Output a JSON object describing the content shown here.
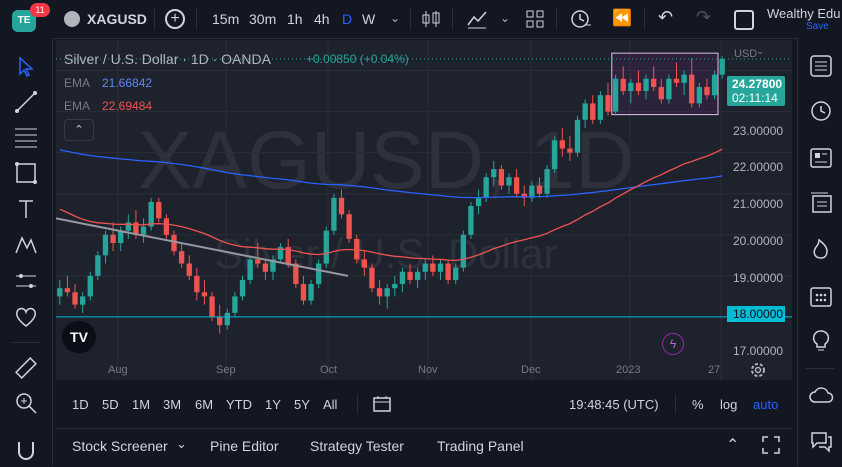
{
  "header": {
    "notification_count": "11",
    "symbol": "XAGUSD",
    "intervals": [
      "15m",
      "30m",
      "1h",
      "4h",
      "D",
      "W"
    ],
    "active_interval": "D",
    "layout_name": "Wealthy Edu",
    "save_label": "Save"
  },
  "legend": {
    "title": "Silver / U.S. Dollar · 1D · OANDA",
    "change": "+0.00850 (+0.04%)",
    "ema1_label": "EMA",
    "ema1_value": "21.66842",
    "ema2_label": "EMA",
    "ema2_value": "22.69484"
  },
  "watermark": {
    "symbol": "XAGUSD, 1D",
    "name": "Silver / U.S. Dollar"
  },
  "price_axis": {
    "currency": "USD",
    "ticks": [
      "23.00000",
      "22.00000",
      "21.00000",
      "20.00000",
      "19.00000",
      "18.00000",
      "17.00000"
    ],
    "current_price": "24.27800",
    "countdown": "02:11:14",
    "line_price": "18.00000"
  },
  "time_axis": {
    "ticks": [
      "Aug",
      "Sep",
      "Oct",
      "Nov",
      "Dec",
      "2023",
      "27"
    ]
  },
  "ranges": [
    "1D",
    "5D",
    "1M",
    "3M",
    "6M",
    "YTD",
    "1Y",
    "5Y",
    "All"
  ],
  "clock": "19:48:45 (UTC)",
  "scale_options": {
    "percent": "%",
    "log": "log",
    "auto": "auto"
  },
  "bottom_tabs": [
    "Stock Screener",
    "Pine Editor",
    "Strategy Tester",
    "Trading Panel"
  ],
  "colors": {
    "up": "#26a69a",
    "down": "#ef5350",
    "ema_fast": "#ef5350",
    "ema_slow": "#2962ff",
    "accent": "#2962ff",
    "hline": "#00bcd4"
  },
  "chart_data": {
    "type": "candlestick",
    "ylim": [
      17.0,
      24.5
    ],
    "candles": [
      [
        18.5,
        18.9,
        18.3,
        18.7
      ],
      [
        18.7,
        19.0,
        18.5,
        18.6
      ],
      [
        18.6,
        18.8,
        18.2,
        18.3
      ],
      [
        18.3,
        18.6,
        18.1,
        18.5
      ],
      [
        18.5,
        19.1,
        18.4,
        19.0
      ],
      [
        19.0,
        19.6,
        18.9,
        19.5
      ],
      [
        19.5,
        20.1,
        19.3,
        20.0
      ],
      [
        20.0,
        20.3,
        19.6,
        19.8
      ],
      [
        19.8,
        20.2,
        19.6,
        20.1
      ],
      [
        20.1,
        20.5,
        19.9,
        20.3
      ],
      [
        20.3,
        20.6,
        19.9,
        20.0
      ],
      [
        20.0,
        20.4,
        19.8,
        20.2
      ],
      [
        20.2,
        20.9,
        20.1,
        20.8
      ],
      [
        20.8,
        20.9,
        20.3,
        20.4
      ],
      [
        20.4,
        20.5,
        19.9,
        20.0
      ],
      [
        20.0,
        20.1,
        19.5,
        19.6
      ],
      [
        19.6,
        19.8,
        19.2,
        19.3
      ],
      [
        19.3,
        19.5,
        18.9,
        19.0
      ],
      [
        19.0,
        19.2,
        18.4,
        18.6
      ],
      [
        18.6,
        18.9,
        18.3,
        18.5
      ],
      [
        18.5,
        18.6,
        17.9,
        18.0
      ],
      [
        18.0,
        18.3,
        17.6,
        17.8
      ],
      [
        17.8,
        18.2,
        17.7,
        18.1
      ],
      [
        18.1,
        18.6,
        18.0,
        18.5
      ],
      [
        18.5,
        19.0,
        18.4,
        18.9
      ],
      [
        18.9,
        19.5,
        18.8,
        19.4
      ],
      [
        19.4,
        19.8,
        19.2,
        19.3
      ],
      [
        19.3,
        19.4,
        18.9,
        19.1
      ],
      [
        19.1,
        19.5,
        18.9,
        19.4
      ],
      [
        19.4,
        19.8,
        19.3,
        19.7
      ],
      [
        19.7,
        19.9,
        19.2,
        19.3
      ],
      [
        19.3,
        19.4,
        18.7,
        18.8
      ],
      [
        18.8,
        19.0,
        18.3,
        18.4
      ],
      [
        18.4,
        18.9,
        18.3,
        18.8
      ],
      [
        18.8,
        19.4,
        18.7,
        19.3
      ],
      [
        19.3,
        20.2,
        19.2,
        20.1
      ],
      [
        20.1,
        21.0,
        20.0,
        20.9
      ],
      [
        20.9,
        21.1,
        20.4,
        20.5
      ],
      [
        20.5,
        20.6,
        19.8,
        19.9
      ],
      [
        19.9,
        20.0,
        19.3,
        19.4
      ],
      [
        19.4,
        19.6,
        19.0,
        19.2
      ],
      [
        19.2,
        19.3,
        18.6,
        18.7
      ],
      [
        18.7,
        18.9,
        18.3,
        18.5
      ],
      [
        18.5,
        18.8,
        18.2,
        18.7
      ],
      [
        18.7,
        19.0,
        18.5,
        18.8
      ],
      [
        18.8,
        19.2,
        18.6,
        19.1
      ],
      [
        19.1,
        19.3,
        18.8,
        18.9
      ],
      [
        18.9,
        19.2,
        18.7,
        19.1
      ],
      [
        19.1,
        19.4,
        18.9,
        19.3
      ],
      [
        19.3,
        19.5,
        19.0,
        19.1
      ],
      [
        19.1,
        19.4,
        18.9,
        19.3
      ],
      [
        19.3,
        19.4,
        18.8,
        18.9
      ],
      [
        18.9,
        19.3,
        18.8,
        19.2
      ],
      [
        19.2,
        20.1,
        19.1,
        20.0
      ],
      [
        20.0,
        20.8,
        19.9,
        20.7
      ],
      [
        20.7,
        21.1,
        20.5,
        20.9
      ],
      [
        20.9,
        21.5,
        20.8,
        21.4
      ],
      [
        21.4,
        21.8,
        21.2,
        21.6
      ],
      [
        21.6,
        21.7,
        21.1,
        21.2
      ],
      [
        21.2,
        21.5,
        21.0,
        21.4
      ],
      [
        21.4,
        21.6,
        20.9,
        21.0
      ],
      [
        21.0,
        21.2,
        20.7,
        20.9
      ],
      [
        20.9,
        21.3,
        20.8,
        21.2
      ],
      [
        21.2,
        21.4,
        20.9,
        21.0
      ],
      [
        21.0,
        21.7,
        20.9,
        21.6
      ],
      [
        21.6,
        22.4,
        21.5,
        22.3
      ],
      [
        22.3,
        22.6,
        21.9,
        22.1
      ],
      [
        22.1,
        22.4,
        21.8,
        22.0
      ],
      [
        22.0,
        22.9,
        21.9,
        22.8
      ],
      [
        22.8,
        23.3,
        22.6,
        23.2
      ],
      [
        23.2,
        23.4,
        22.7,
        22.8
      ],
      [
        22.8,
        23.5,
        22.7,
        23.4
      ],
      [
        23.4,
        23.7,
        22.9,
        23.0
      ],
      [
        23.0,
        23.9,
        22.9,
        23.8
      ],
      [
        23.8,
        24.1,
        23.4,
        23.5
      ],
      [
        23.5,
        23.8,
        23.2,
        23.7
      ],
      [
        23.7,
        24.0,
        23.4,
        23.5
      ],
      [
        23.5,
        23.9,
        23.3,
        23.8
      ],
      [
        23.8,
        24.1,
        23.5,
        23.6
      ],
      [
        23.6,
        23.8,
        23.2,
        23.3
      ],
      [
        23.3,
        23.9,
        23.2,
        23.8
      ],
      [
        23.8,
        24.2,
        23.6,
        23.7
      ],
      [
        23.7,
        24.0,
        23.4,
        23.9
      ],
      [
        23.9,
        24.3,
        23.1,
        23.2
      ],
      [
        23.2,
        23.7,
        23.1,
        23.6
      ],
      [
        23.6,
        23.8,
        23.3,
        23.4
      ],
      [
        23.4,
        24.0,
        23.3,
        23.9
      ],
      [
        23.9,
        24.35,
        23.8,
        24.28
      ]
    ],
    "ema_fast_label": "EMA",
    "ema_slow_label": "EMA",
    "hline": 18.0
  }
}
